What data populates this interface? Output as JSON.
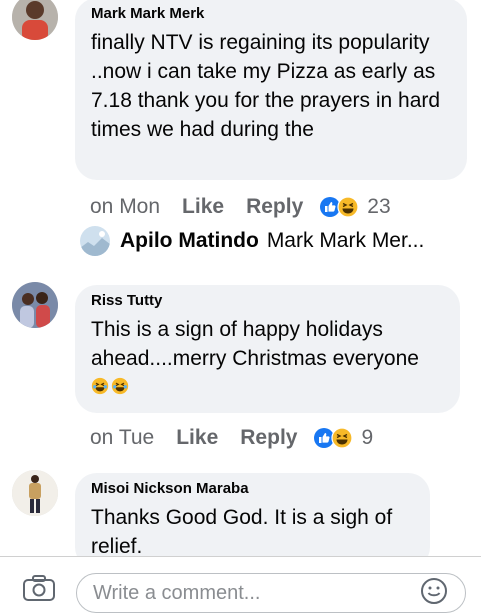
{
  "colors": {
    "bubble": "#f0f2f5",
    "meta_text": "#65676b",
    "like_blue": "#1877f2",
    "haha_yellow": "#f7b928"
  },
  "comments": [
    {
      "author": "Mark Mark Merk",
      "text": "finally NTV is regaining its popularity ..now i can take my Pizza as early as 7.18 thank you for the prayers in hard times we had during the",
      "time": "on Mon",
      "like_label": "Like",
      "reply_label": "Reply",
      "reactions": [
        "like-icon",
        "haha-icon"
      ],
      "reaction_count": "23"
    },
    {
      "author": "Riss Tutty",
      "text": "This is a sign of happy holidays ahead....merry Christmas everyone",
      "emojis": [
        "laughing-emoji",
        "laughing-emoji"
      ],
      "time": "on Tue",
      "like_label": "Like",
      "reply_label": "Reply",
      "reactions": [
        "like-icon",
        "haha-icon"
      ],
      "reaction_count": "9"
    },
    {
      "author": "Misoi Nickson Maraba",
      "text": "Thanks Good God. It is a sigh of relief."
    }
  ],
  "reply_preview": {
    "author": "Apilo Matindo",
    "snippet": "Mark Mark Mer..."
  },
  "composer": {
    "placeholder": "Write a comment...",
    "camera_icon": "camera-icon",
    "emoji_icon": "smiley-icon"
  }
}
